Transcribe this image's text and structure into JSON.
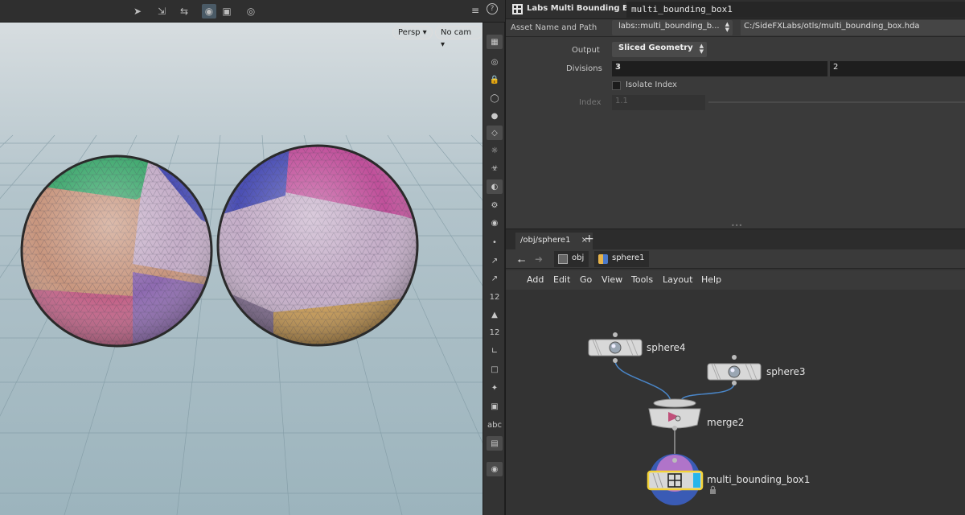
{
  "viewport": {
    "camera_view": "Persp",
    "camera_select": "No cam",
    "toolbar_icons": [
      "select-icon",
      "transform-icon",
      "handle-icon",
      "snapping-icon",
      "display-icon",
      "record-icon"
    ],
    "right_icons": [
      "layout-icon",
      "help-icon"
    ]
  },
  "side_toolbar": {
    "icons": [
      "grid-display-icon",
      "visibility-icon",
      "lock-icon",
      "ghost-icon",
      "shading-icon",
      "light-icon",
      "headlight-icon",
      "bones-icon",
      "background-icon",
      "display-options-icon",
      "render-icon",
      "point-icon",
      "normal-icon",
      "vector-icon",
      "point-number-icon",
      "primitive-icon",
      "primitive-number-icon",
      "uv-icon",
      "boundary-icon",
      "pivot-icon",
      "bounding-box-icon",
      "text-label-icon",
      "snapshot-icon",
      "marker-icon"
    ],
    "text_label": "abc",
    "number_label": "12"
  },
  "params": {
    "node_type": "Labs Multi Bounding Box",
    "node_name": "multi_bounding_box1",
    "asset_label": "Asset Name and Path",
    "asset_name": "labs::multi_bounding_b...",
    "asset_path": "C:/SideFXLabs/otls/multi_bounding_box.hda",
    "output_label": "Output",
    "output_value": "Sliced Geometry",
    "divisions_label": "Divisions",
    "divisions_x": "3",
    "divisions_y": "2",
    "isolate_label": "Isolate Index",
    "index_label": "Index",
    "index_value": "1.1"
  },
  "network": {
    "tab_label": "/obj/sphere1",
    "tab_close": "×",
    "add_tab": "+",
    "path_root": "obj",
    "path_node": "sphere1",
    "menu": [
      "Add",
      "Edit",
      "Go",
      "View",
      "Tools",
      "Layout",
      "Help"
    ],
    "nodes": {
      "sphere4": "sphere4",
      "sphere3": "sphere3",
      "merge2": "merge2",
      "multi_bounding_box1": "multi_bounding_box1"
    }
  },
  "colors": {
    "selected_node": "#f3d338",
    "display_flag": "#27b5ea",
    "sphere_orange": "#c8967e",
    "sphere_lilac": "#c5aec8",
    "sphere_green": "#3fa86e",
    "sphere_blue": "#4b4fb4",
    "sphere_magenta": "#c0509a",
    "sphere_gold": "#c99a52"
  }
}
